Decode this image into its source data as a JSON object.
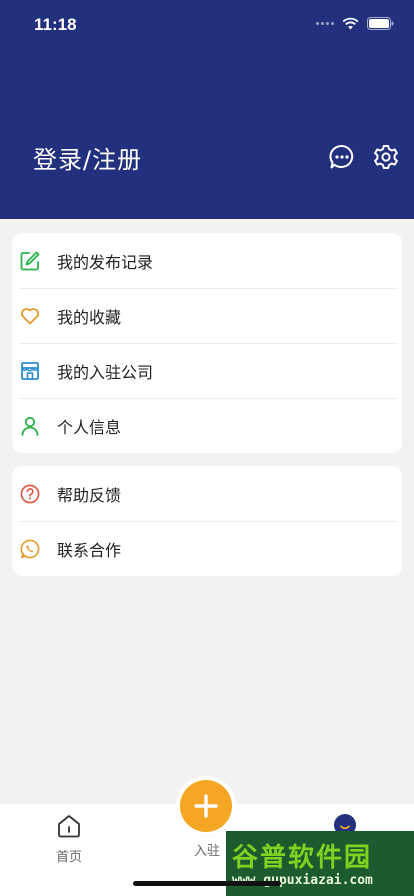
{
  "status_bar": {
    "time": "11:18"
  },
  "header": {
    "title": "登录/注册",
    "background": "#22307e"
  },
  "menu_group_1": [
    {
      "label": "我的发布记录",
      "icon": "edit-icon",
      "color": "#2bb24c"
    },
    {
      "label": "我的收藏",
      "icon": "heart-icon",
      "color": "#e39b2e"
    },
    {
      "label": "我的入驻公司",
      "icon": "store-icon",
      "color": "#2e8ecf"
    },
    {
      "label": "个人信息",
      "icon": "user-icon",
      "color": "#2bb24c"
    }
  ],
  "menu_group_2": [
    {
      "label": "帮助反馈",
      "icon": "help-icon",
      "color": "#e0533c"
    },
    {
      "label": "联系合作",
      "icon": "phone-icon",
      "color": "#e39b2e"
    }
  ],
  "tabbar": {
    "home": "首页",
    "join": "入驻",
    "mine_icon": "avatar-icon",
    "accent": "#f6a623"
  },
  "watermark": {
    "main": "谷普软件园",
    "sub": "www.gupuxiazai.com"
  }
}
